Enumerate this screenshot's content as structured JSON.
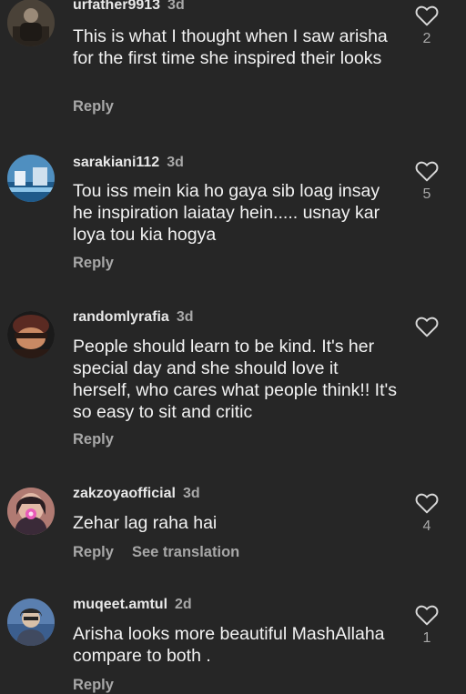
{
  "comments": [
    {
      "username": "urfather9913",
      "time": "3d",
      "text": "This is what I thought when I saw arisha for the first time she inspired their looks",
      "reply_label": "Reply",
      "likes": "2"
    },
    {
      "username": "sarakiani112",
      "time": "3d",
      "text": "Tou iss mein  kia ho gaya sib loag insay he inspiration laiatay hein..... usnay kar loya tou kia hogya",
      "reply_label": "Reply",
      "likes": "5"
    },
    {
      "username": "randomlyrafia",
      "time": "3d",
      "text": "People should learn to be kind. It's her special day and she should love it herself, who cares what people think!! It's so easy to sit and critic",
      "reply_label": "Reply",
      "likes": ""
    },
    {
      "username": "zakzoyaofficial",
      "time": "3d",
      "text": "Zehar lag raha hai",
      "reply_label": "Reply",
      "translate_label": "See translation",
      "likes": "4"
    },
    {
      "username": "muqeet.amtul",
      "time": "2d",
      "text": "Arisha looks more beautiful MashAllaha compare to both .",
      "reply_label": "Reply",
      "likes": "1"
    }
  ]
}
